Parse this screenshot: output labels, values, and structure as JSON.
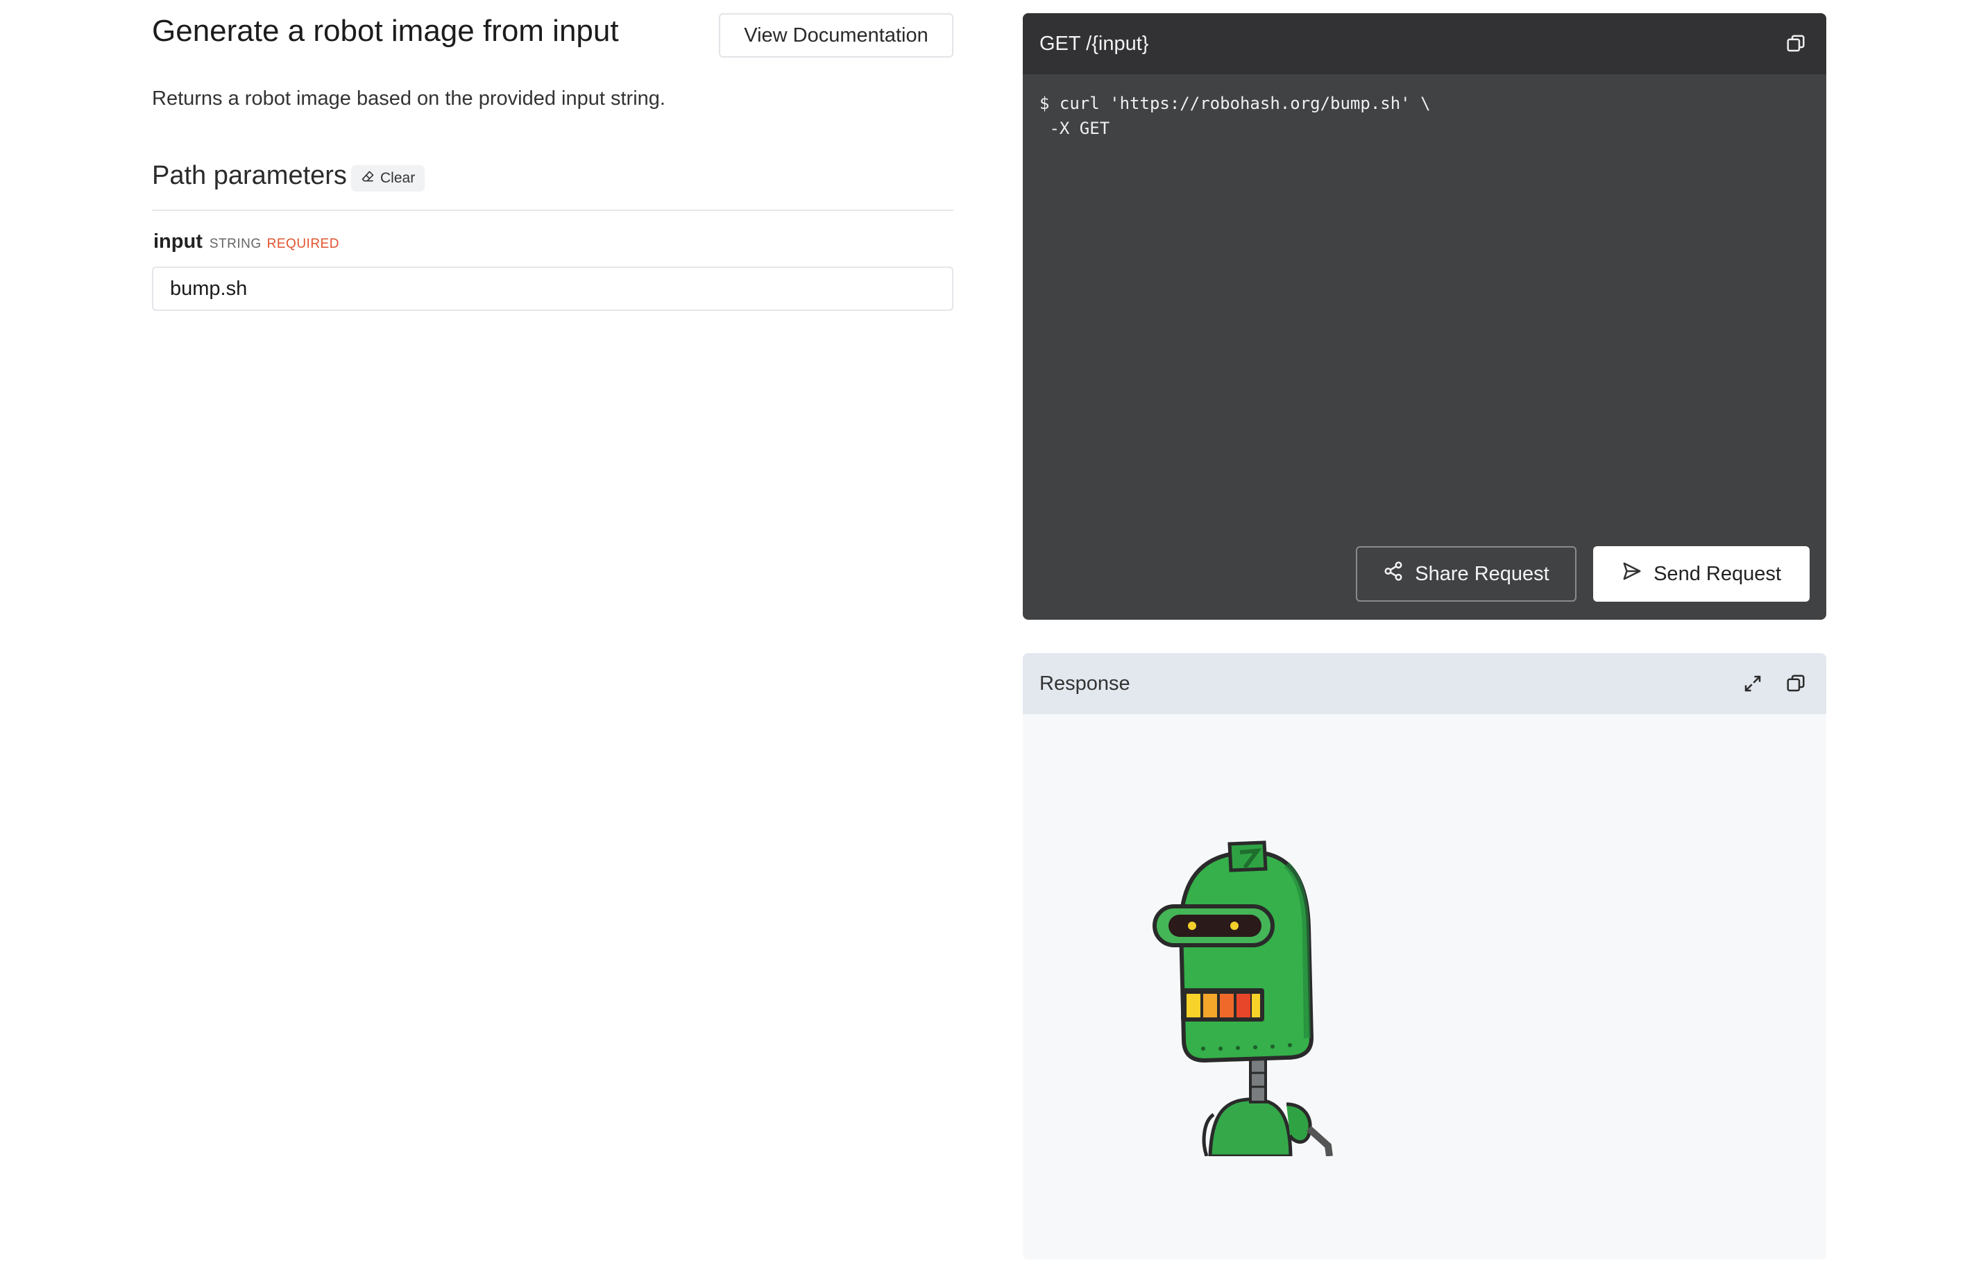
{
  "header": {
    "title": "Generate a robot image from input",
    "doc_button": "View Documentation",
    "description": "Returns a robot image based on the provided input string."
  },
  "path_params": {
    "title": "Path parameters",
    "clear_label": "Clear",
    "param": {
      "name": "input",
      "type": "STRING",
      "required": "REQUIRED",
      "value": "bump.sh"
    }
  },
  "request": {
    "title": "GET /{input}",
    "code_line1": "$ curl 'https://robohash.org/bump.sh' \\",
    "code_line2": " -X GET",
    "share_label": "Share Request",
    "send_label": "Send Request"
  },
  "response": {
    "title": "Response"
  },
  "icons": {
    "copy": "copy-icon",
    "expand": "expand-icon",
    "share": "share-icon",
    "send": "send-icon",
    "eraser": "eraser-icon"
  }
}
